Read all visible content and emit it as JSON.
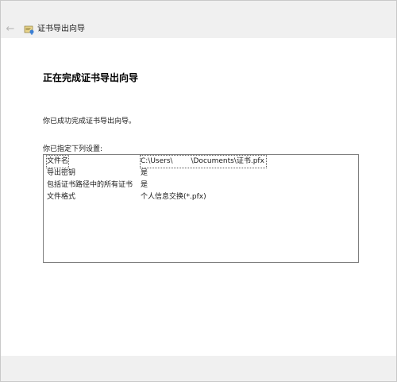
{
  "window": {
    "title": "证书导出向导",
    "back_icon": "←"
  },
  "main": {
    "heading": "正在完成证书导出向导",
    "success_message": "你已成功完成证书导出向导。",
    "list_label": "你已指定下列设置:",
    "settings": [
      {
        "key": "文件名",
        "value": "C:\\Users\\        \\Documents\\证书.pfx"
      },
      {
        "key": "导出密钥",
        "value": "是"
      },
      {
        "key": "包括证书路径中的所有证书",
        "value": "是"
      },
      {
        "key": "文件格式",
        "value": "个人信息交换(*.pfx)"
      }
    ]
  },
  "colors": {
    "titlebar_bg": "#f0f0f0",
    "footer_bg": "#f0f0f0",
    "box_border": "#7f7f7f"
  }
}
